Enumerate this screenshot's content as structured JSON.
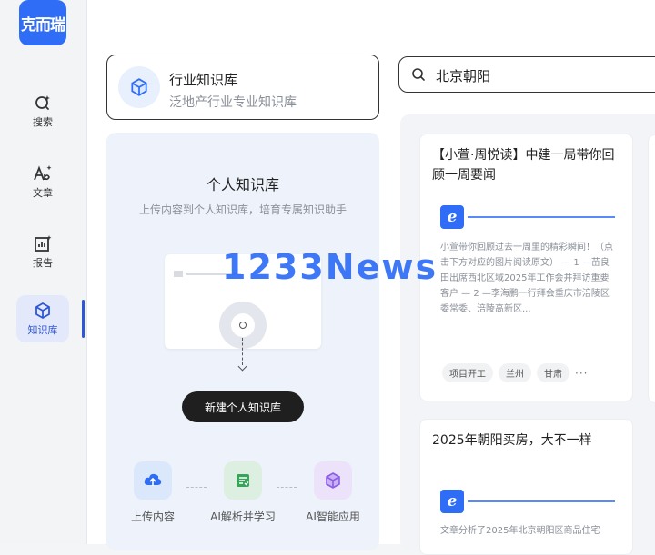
{
  "app": {
    "logo_text": "克而瑞"
  },
  "sidebar": {
    "items": [
      {
        "label": "搜索",
        "icon": "search-sparkle-icon"
      },
      {
        "label": "文章",
        "icon": "text-sparkle-icon"
      },
      {
        "label": "报告",
        "icon": "chart-sparkle-icon"
      },
      {
        "label": "知识库",
        "icon": "cube-icon",
        "active": true
      }
    ]
  },
  "industry_kb": {
    "title": "行业知识库",
    "subtitle": "泛地产行业专业知识库",
    "icon": "cube-icon"
  },
  "search": {
    "value": "北京朝阳",
    "icon": "search-icon"
  },
  "personal_kb": {
    "title": "个人知识库",
    "subtitle": "上传内容到个人知识库，培育专属知识助手",
    "button": "新建个人知识库",
    "steps": [
      {
        "label": "上传内容",
        "icon": "cloud-upload-icon"
      },
      {
        "label": "AI解析并学习",
        "icon": "document-ai-icon"
      },
      {
        "label": "AI智能应用",
        "icon": "cube-icon"
      }
    ]
  },
  "news": [
    {
      "title": "【小萱·周悦读】中建一局带你回顾一周要闻",
      "body": "小萱带你回顾过去一周里的精彩瞬间！（点击下方对应的图片阅读原文） — 1 —苗良田出席西北区域2025年工作会并拜访重要客户 — 2 —李海鹏一行拜会重庆市涪陵区委常委、涪陵高新区...",
      "tags": [
        "项目开工",
        "兰州",
        "甘肃"
      ],
      "more": "···"
    },
    {
      "title": "2025年朝阳买房，大不一样",
      "body": "文章分析了2025年北京朝阳区商品住宅",
      "tags": [],
      "more": ""
    }
  ],
  "watermark": "1233News",
  "colors": {
    "brand": "#2f6df6",
    "active_nav": "#e3e9fb",
    "button": "#1f1f1f"
  }
}
